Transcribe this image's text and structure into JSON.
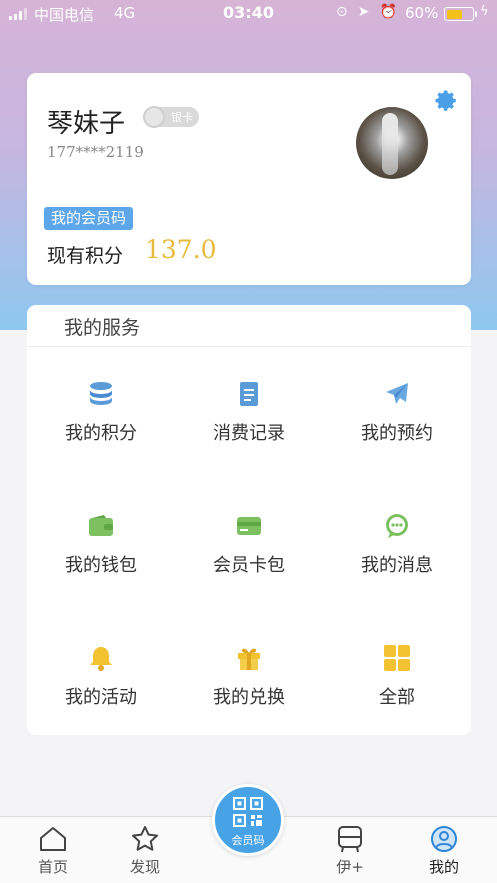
{
  "status_bar": {
    "carrier": "中国电信",
    "network": "4G",
    "time": "03:40",
    "battery": "60%",
    "battery_level": 0.6
  },
  "profile": {
    "name": "琴妹子",
    "badge": "银卡",
    "phone": "177****2119",
    "member_code_label": "我的会员码",
    "points_label": "现有积分",
    "points_value": "137.0"
  },
  "services": {
    "title": "我的服务",
    "items": [
      {
        "label": "我的积分",
        "icon": "coins-stack-icon",
        "color": "#5b9bd8"
      },
      {
        "label": "消费记录",
        "icon": "document-icon",
        "color": "#5b9bd8"
      },
      {
        "label": "我的预约",
        "icon": "paper-plane-icon",
        "color": "#6aa8e0"
      },
      {
        "label": "我的钱包",
        "icon": "wallet-icon",
        "color": "#7cc060"
      },
      {
        "label": "会员卡包",
        "icon": "card-icon",
        "color": "#7cc060"
      },
      {
        "label": "我的消息",
        "icon": "message-bubble-icon",
        "color": "#7cc060"
      },
      {
        "label": "我的活动",
        "icon": "bell-icon",
        "color": "#f2c230"
      },
      {
        "label": "我的兑换",
        "icon": "gift-icon",
        "color": "#f2c230"
      },
      {
        "label": "全部",
        "icon": "grid-icon",
        "color": "#f2c230"
      }
    ]
  },
  "tabbar": {
    "home": "首页",
    "discover": "发现",
    "center": "会员码",
    "yi_plus": "伊+",
    "mine": "我的"
  }
}
